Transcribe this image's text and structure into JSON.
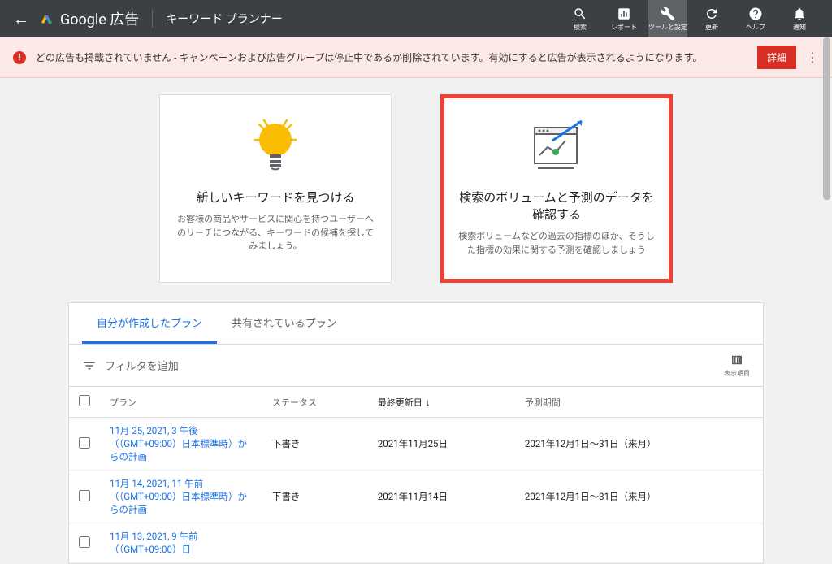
{
  "header": {
    "brand": "Google 広告",
    "page_title": "キーワード プランナー",
    "icons": {
      "search": "検索",
      "report": "レポート",
      "tools": "ツールと設定",
      "refresh": "更新",
      "help": "ヘルプ",
      "notifications": "通知"
    }
  },
  "alert": {
    "text": "どの広告も掲載されていません - キャンペーンおよび広告グループは停止中であるか削除されています。有効にすると広告が表示されるようになります。",
    "detail_btn": "詳細"
  },
  "cards": {
    "discover": {
      "title": "新しいキーワードを見つける",
      "desc": "お客様の商品やサービスに関心を持つユーザーへのリーチにつながる、キーワードの候補を探してみましょう。"
    },
    "forecast": {
      "title": "検索のボリュームと予測のデータを確認する",
      "desc": "検索ボリュームなどの過去の指標のほか、そうした指標の効果に関する予測を確認しましょう"
    }
  },
  "tabs": {
    "my_plans": "自分が作成したプラン",
    "shared_plans": "共有されているプラン"
  },
  "toolbar": {
    "filter": "フィルタを追加",
    "columns": "表示項目"
  },
  "table": {
    "headers": {
      "plan": "プラン",
      "status": "ステータス",
      "updated": "最終更新日",
      "forecast_period": "予測期間"
    },
    "rows": [
      {
        "plan": "11月 25, 2021, 3 午後（（GMT+09:00）日本標準時）からの計画",
        "status": "下書き",
        "updated": "2021年11月25日",
        "period": "2021年12月1日～31日（来月）"
      },
      {
        "plan": "11月 14, 2021, 11 午前（（GMT+09:00）日本標準時）からの計画",
        "status": "下書き",
        "updated": "2021年11月14日",
        "period": "2021年12月1日～31日（来月）"
      },
      {
        "plan": "11月 13, 2021, 9 午前（（GMT+09:00）日",
        "status": "",
        "updated": "",
        "period": ""
      }
    ]
  }
}
